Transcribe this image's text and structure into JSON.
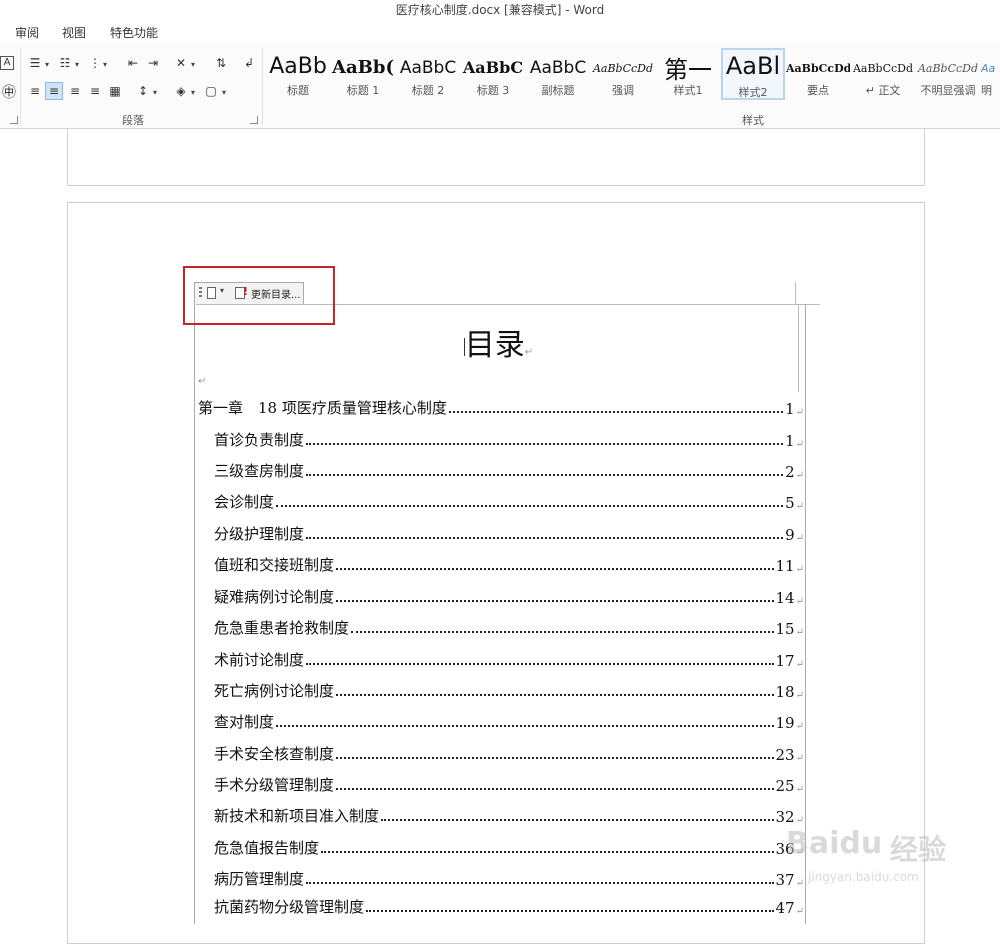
{
  "window": {
    "title": "医疗核心制度.docx [兼容模式] - Word"
  },
  "tabs": [
    "审阅",
    "视图",
    "特色功能"
  ],
  "ribbon": {
    "paragraph_group": "段落",
    "styles_group": "样式",
    "styles": [
      {
        "preview": "AaBb",
        "name": "标题"
      },
      {
        "preview": "AaBb(",
        "name": "标题 1"
      },
      {
        "preview": "AaBbC",
        "name": "标题 2"
      },
      {
        "preview": "AaBbC",
        "name": "标题 3"
      },
      {
        "preview": "AaBbC",
        "name": "副标题"
      },
      {
        "preview": "AaBbCcDd",
        "name": "强调"
      },
      {
        "preview": "第一",
        "name": "样式1"
      },
      {
        "preview": "AaBl",
        "name": "样式2"
      },
      {
        "preview": "AaBbCcDd",
        "name": "要点"
      },
      {
        "preview": "AaBbCcDd",
        "name": "↵ 正文"
      },
      {
        "preview": "AaBbCcDd",
        "name": "不明显强调"
      },
      {
        "preview": "Aa",
        "name": "明"
      }
    ],
    "selected_style": "样式2"
  },
  "toc_control": {
    "update_label": "更新目录..."
  },
  "toc": {
    "title": "目录",
    "entries": [
      {
        "label": "第一章　18 项医疗质量管理核心制度",
        "page": "1"
      },
      {
        "label": "首诊负责制度",
        "page": "1"
      },
      {
        "label": "三级查房制度",
        "page": "2"
      },
      {
        "label": "会诊制度",
        "page": "5"
      },
      {
        "label": "分级护理制度",
        "page": "9"
      },
      {
        "label": "值班和交接班制度",
        "page": "11"
      },
      {
        "label": "疑难病例讨论制度",
        "page": "14"
      },
      {
        "label": "危急重患者抢救制度",
        "page": "15"
      },
      {
        "label": "术前讨论制度",
        "page": "17"
      },
      {
        "label": "死亡病例讨论制度",
        "page": "18"
      },
      {
        "label": "查对制度",
        "page": "19"
      },
      {
        "label": "手术安全核查制度",
        "page": "23"
      },
      {
        "label": "手术分级管理制度",
        "page": "25"
      },
      {
        "label": "新技术和新项目准入制度",
        "page": "32"
      },
      {
        "label": "危急值报告制度",
        "page": "36"
      },
      {
        "label": "病历管理制度",
        "page": "37"
      },
      {
        "label": "抗菌药物分级管理制度",
        "page": "47"
      }
    ]
  },
  "watermark": {
    "text1": "Baidu",
    "text2": "经验",
    "text3": "jingyan.baidu.com"
  }
}
